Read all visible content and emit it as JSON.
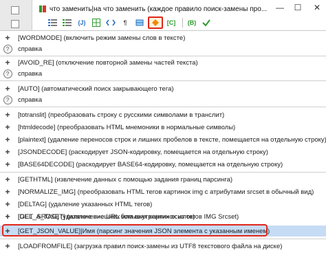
{
  "window": {
    "title": "что заменить|на что заменить (каждое правило поиск-замены про...",
    "minimize_glyph": "—",
    "maximize_glyph": "☐",
    "close_glyph": "✕"
  },
  "toolbar": {
    "btn_j_label": "(J)",
    "btn_c_label": "[C]",
    "btn_b_label": "(B)",
    "pilcrow": "¶"
  },
  "colors": {
    "highlight_border": "#e0261a",
    "selected_row": "#c6dcf5",
    "toolbar_green": "#2e9a2e",
    "toolbar_orange": "#f08a00"
  },
  "rows": [
    {
      "kind": "plus",
      "text": "[WORDMODE] (включить режим замены слов в тексте)"
    },
    {
      "kind": "help",
      "text": "справка"
    },
    {
      "kind": "plus",
      "text": "[AVOID_RE] (отключение повторной замены частей текста)"
    },
    {
      "kind": "help",
      "text": "справка"
    },
    {
      "kind": "plus",
      "text": "[AUTO] (автоматический поиск закрывающего тега)"
    },
    {
      "kind": "help",
      "text": "справка"
    },
    {
      "kind": "plus",
      "text": "[totranslit] (преобразовать строку с русскими символами в транслит)"
    },
    {
      "kind": "plus",
      "text": "[htmldecode] (преобразовать HTML мнемоники в нормальные символы)"
    },
    {
      "kind": "plus",
      "text": "[plaintext] (удаление переносов строк и лишних пробелов в тексте, помещается на отдельную строку)"
    },
    {
      "kind": "plus",
      "text": "[JSONDECODE] (раскодирует JSON-кодировку, помещается на отдельную строку)"
    },
    {
      "kind": "plus",
      "text": "[BASE64DECODE] (раскодирует BASE64-кодировку, помещается на отдельную строку)"
    },
    {
      "kind": "plus",
      "text": "[GETHTML] (извлечение данных с помощью задания границ парсинга)"
    },
    {
      "kind": "plus",
      "text": "[NORMALIZE_IMG] (преобразовать HTML тегов картинок img с атрибутами srcset в обычный вид)"
    },
    {
      "kind": "plus",
      "text": "[DELTAG] (удаление указанных HTML тегов)"
    },
    {
      "kind": "plus",
      "text": "[DEL_A_TAG] (удаление внешних или внутренних ссылок)"
    },
    {
      "kind": "plus",
      "text": "[GET_SRCSET] (извлечение URL больших картинок из тегов IMG Srcset)"
    },
    {
      "kind": "plus",
      "text": "[GET_JSON_VALUE]|Имя (парсинг значения JSON элемента с указанным именем)",
      "selected": true
    },
    {
      "kind": "plus",
      "text": "[LOADFROMFILE] (загрузка правил поиск-замены из UTF8 текстового файла на диске)"
    }
  ]
}
